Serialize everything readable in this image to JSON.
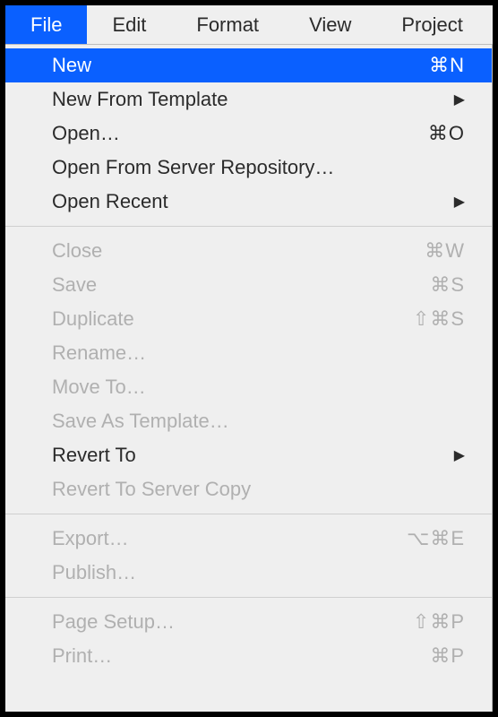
{
  "menubar": [
    {
      "id": "file",
      "label": "File",
      "active": true
    },
    {
      "id": "edit",
      "label": "Edit",
      "active": false
    },
    {
      "id": "format",
      "label": "Format",
      "active": false
    },
    {
      "id": "view",
      "label": "View",
      "active": false
    },
    {
      "id": "project",
      "label": "Project",
      "active": false
    }
  ],
  "fileMenu": {
    "groups": [
      [
        {
          "id": "new",
          "label": "New",
          "shortcut": "⌘N",
          "submenu": false,
          "disabled": false,
          "highlighted": true
        },
        {
          "id": "new-template",
          "label": "New From Template",
          "shortcut": "",
          "submenu": true,
          "disabled": false,
          "highlighted": false
        },
        {
          "id": "open",
          "label": "Open…",
          "shortcut": "⌘O",
          "submenu": false,
          "disabled": false,
          "highlighted": false
        },
        {
          "id": "open-server",
          "label": "Open From Server Repository…",
          "shortcut": "",
          "submenu": false,
          "disabled": false,
          "highlighted": false
        },
        {
          "id": "open-recent",
          "label": "Open Recent",
          "shortcut": "",
          "submenu": true,
          "disabled": false,
          "highlighted": false
        }
      ],
      [
        {
          "id": "close",
          "label": "Close",
          "shortcut": "⌘W",
          "submenu": false,
          "disabled": true,
          "highlighted": false
        },
        {
          "id": "save",
          "label": "Save",
          "shortcut": "⌘S",
          "submenu": false,
          "disabled": true,
          "highlighted": false
        },
        {
          "id": "duplicate",
          "label": "Duplicate",
          "shortcut": "⇧⌘S",
          "submenu": false,
          "disabled": true,
          "highlighted": false
        },
        {
          "id": "rename",
          "label": "Rename…",
          "shortcut": "",
          "submenu": false,
          "disabled": true,
          "highlighted": false
        },
        {
          "id": "move-to",
          "label": "Move To…",
          "shortcut": "",
          "submenu": false,
          "disabled": true,
          "highlighted": false
        },
        {
          "id": "save-template",
          "label": "Save As Template…",
          "shortcut": "",
          "submenu": false,
          "disabled": true,
          "highlighted": false
        },
        {
          "id": "revert-to",
          "label": "Revert To",
          "shortcut": "",
          "submenu": true,
          "disabled": false,
          "highlighted": false
        },
        {
          "id": "revert-server",
          "label": "Revert To Server Copy",
          "shortcut": "",
          "submenu": false,
          "disabled": true,
          "highlighted": false
        }
      ],
      [
        {
          "id": "export",
          "label": "Export…",
          "shortcut": "⌥⌘E",
          "submenu": false,
          "disabled": true,
          "highlighted": false
        },
        {
          "id": "publish",
          "label": "Publish…",
          "shortcut": "",
          "submenu": false,
          "disabled": true,
          "highlighted": false
        }
      ],
      [
        {
          "id": "page-setup",
          "label": "Page Setup…",
          "shortcut": "⇧⌘P",
          "submenu": false,
          "disabled": true,
          "highlighted": false
        },
        {
          "id": "print",
          "label": "Print…",
          "shortcut": "⌘P",
          "submenu": false,
          "disabled": true,
          "highlighted": false
        }
      ]
    ]
  }
}
